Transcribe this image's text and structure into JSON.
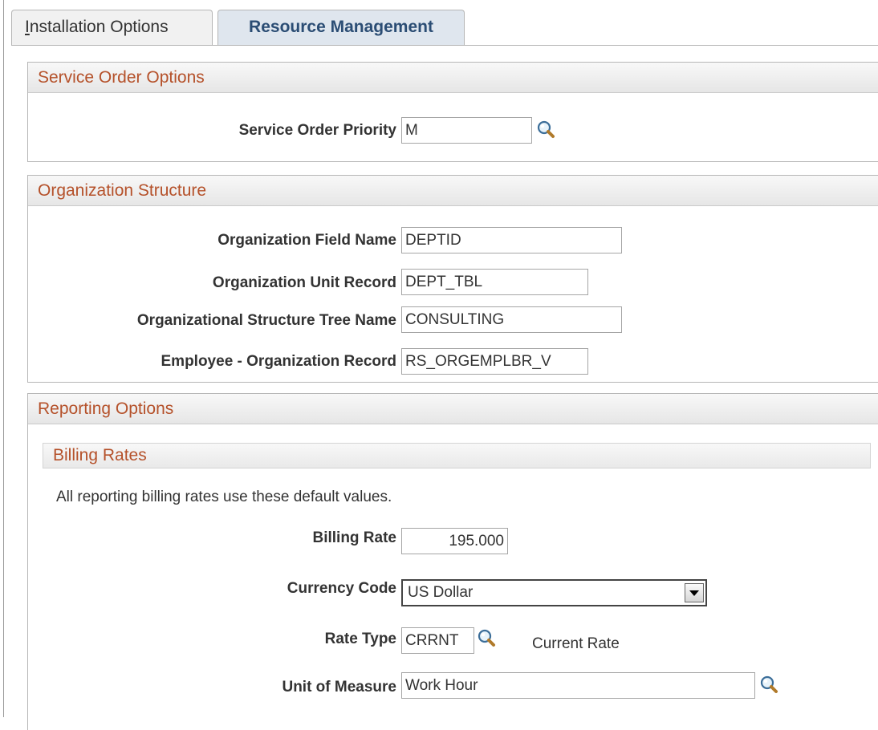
{
  "tabs": [
    {
      "label_first": "I",
      "label_rest": "nstallation Options",
      "active": false
    },
    {
      "label": "Resource Management",
      "active": true
    }
  ],
  "service_order": {
    "title": "Service Order Options",
    "priority_label": "Service Order Priority",
    "priority_value": "M"
  },
  "org_structure": {
    "title": "Organization Structure",
    "field_name_label": "Organization Field Name",
    "field_name_value": "DEPTID",
    "unit_record_label": "Organization Unit Record",
    "unit_record_value": "DEPT_TBL",
    "tree_name_label": "Organizational Structure Tree Name",
    "tree_name_value": "CONSULTING",
    "emp_org_label": "Employee - Organization Record",
    "emp_org_value": "RS_ORGEMPLBR_V"
  },
  "reporting": {
    "title": "Reporting Options",
    "billing_rates": {
      "title": "Billing Rates",
      "note": "All reporting billing rates use these default values.",
      "billing_rate_label": "Billing Rate",
      "billing_rate_value": "195.000",
      "currency_label": "Currency Code",
      "currency_value": "US Dollar",
      "rate_type_label": "Rate Type",
      "rate_type_value": "CRRNT",
      "rate_type_desc": "Current Rate",
      "uom_label": "Unit of Measure",
      "uom_value": "Work Hour"
    }
  },
  "colors": {
    "section_title": "#b5512a",
    "active_tab_text": "#2b4d74",
    "active_tab_bg": "#dfe6ee"
  }
}
